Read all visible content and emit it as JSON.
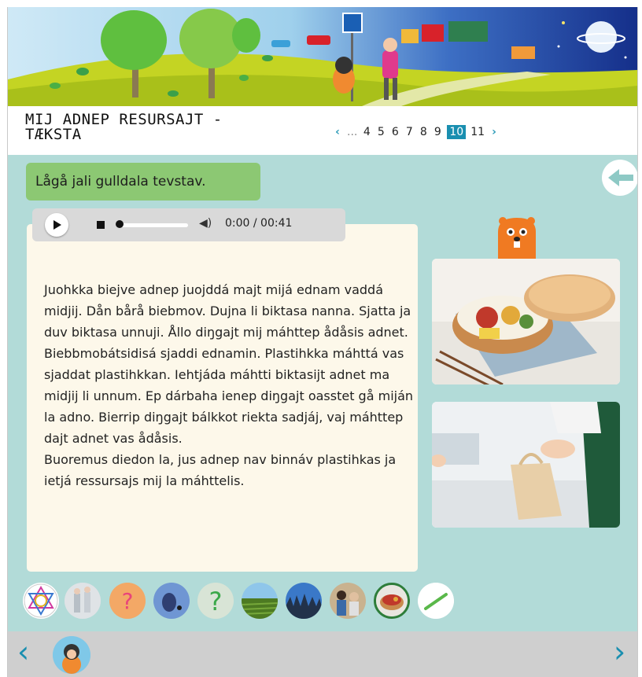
{
  "header": {
    "title": "MIJ ADNEP RESURSAJT -\nTÆKSTA"
  },
  "pager": {
    "prev": "‹",
    "ellipsis": "...",
    "pages": [
      "4",
      "5",
      "6",
      "7",
      "8",
      "9",
      "10",
      "11"
    ],
    "current": "10",
    "next": "›"
  },
  "instruction": "Lågå jali gulldala tevstav.",
  "audio": {
    "time": "0:00 / 00:41",
    "progress": 0
  },
  "body_text": "Juohkka biejve adnep juojddá majt mijá ednam vaddá midjij.  Dån bårå biebmov. Dujna li biktasa nanna. Sjatta ja duv biktasa unnuji. Ållo diŋgajt mij máhttep ådåsis adnet. Biebbmobátsidisá sjaddi ednamin. Plastihkka máhttá vas sjaddat plastihkkan. Iehtjáda máhtti biktasijt adnet ma midjij li unnum. Ep dárbaha ienep diŋgajt oasstet gå miján la adno.  Bierrip diŋgajt bálkkot riekta sadjáj, vaj máhttep dajt adnet vas ådåsis.\n Buoremus diedon la, jus adnep nav binnáv plastihkas ja ietjá ressursajs mij la máhttelis.",
  "bottom_nav": {
    "prev": "‹",
    "next": "›"
  },
  "colors": {
    "background": "#b2dbd8",
    "accent": "#1a8fb0",
    "instruction_bg": "#8cc873",
    "text_panel": "#fdf8ea",
    "footer": "#cfcfcf"
  },
  "icons": {
    "thumbnails": [
      "mandala-icon",
      "people-icon",
      "question-orange-icon",
      "blue-figure-icon",
      "question-green-icon",
      "field-icon",
      "forest-icon",
      "family-icon",
      "lunchbox-icon",
      "straw-icon"
    ]
  }
}
